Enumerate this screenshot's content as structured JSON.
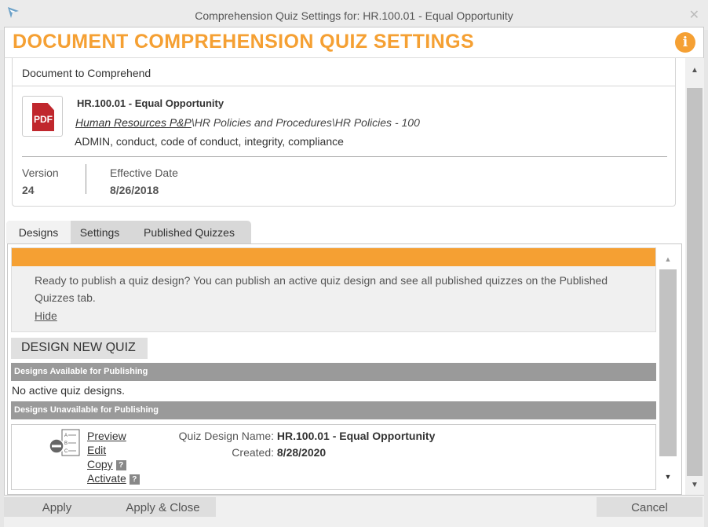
{
  "window": {
    "title": "Comprehension Quiz Settings for: HR.100.01 - Equal Opportunity"
  },
  "header": {
    "title": "DOCUMENT COMPREHENSION QUIZ SETTINGS",
    "info_icon": "i"
  },
  "document": {
    "section_title": "Document to Comprehend",
    "file_type": "PDF",
    "name": "HR.100.01 - Equal Opportunity",
    "path_link": "Human Resources P&P",
    "path_rest": "\\HR Policies and Procedures\\HR Policies - 100",
    "keywords": "ADMIN, conduct, code of conduct, integrity, compliance",
    "version_label": "Version",
    "version_value": "24",
    "effective_label": "Effective Date",
    "effective_value": "8/26/2018"
  },
  "tabs": [
    {
      "label": "Designs",
      "active": true
    },
    {
      "label": "Settings",
      "active": false
    },
    {
      "label": "Published Quizzes",
      "active": false
    }
  ],
  "designs": {
    "notice_text": "Ready to publish a quiz design? You can publish an active quiz design and see all published quizzes on the Published Quizzes tab.",
    "notice_hide": "Hide",
    "new_quiz_button": "DESIGN NEW QUIZ",
    "available_header": "Designs Available for Publishing",
    "no_active": "No active quiz designs.",
    "unavailable_header": "Designs Unavailable for Publishing",
    "quiz": {
      "actions": {
        "preview": "Preview",
        "edit": "Edit",
        "copy": "Copy",
        "activate": "Activate",
        "help": "?"
      },
      "name_label": "Quiz Design Name:",
      "name_value": "HR.100.01 - Equal Opportunity",
      "created_label": "Created:",
      "created_value": "8/28/2020"
    }
  },
  "footer": {
    "apply": "Apply",
    "apply_close": "Apply & Close",
    "cancel": "Cancel"
  },
  "colors": {
    "accent": "#f5a033",
    "pdf_red": "#c0272d",
    "section_gray": "#9a9a9a"
  }
}
